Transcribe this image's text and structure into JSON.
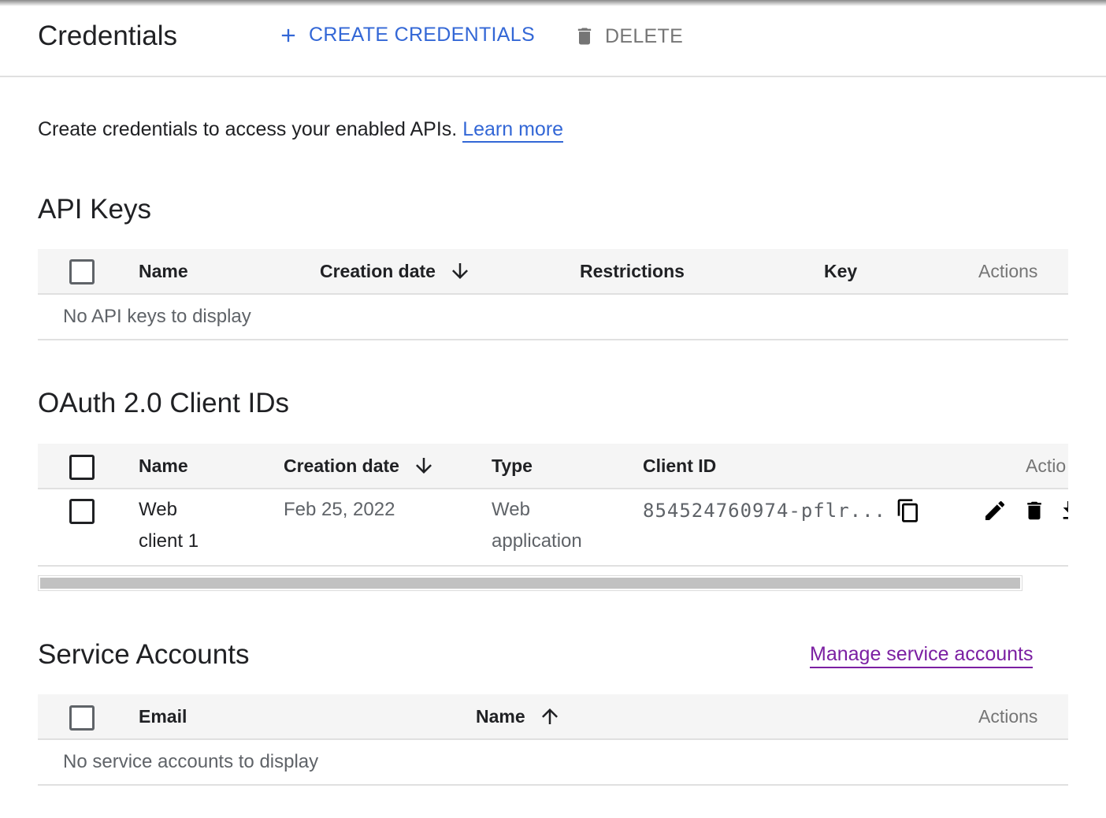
{
  "header": {
    "title": "Credentials",
    "create_label": "CREATE CREDENTIALS",
    "delete_label": "DELETE"
  },
  "intro": {
    "text": "Create credentials to access your enabled APIs.",
    "learn_more": "Learn more"
  },
  "api_keys": {
    "title": "API Keys",
    "columns": [
      "Name",
      "Creation date",
      "Restrictions",
      "Key",
      "Actions"
    ],
    "empty_text": "No API keys to display"
  },
  "oauth": {
    "title": "OAuth 2.0 Client IDs",
    "columns": [
      "Name",
      "Creation date",
      "Type",
      "Client ID",
      "Actio"
    ],
    "rows": [
      {
        "name_line1": "Web",
        "name_line2": "client 1",
        "creation_date": "Feb 25, 2022",
        "type_line1": "Web",
        "type_line2": "application",
        "client_id": "854524760974-pflr..."
      }
    ]
  },
  "service_accounts": {
    "title": "Service Accounts",
    "manage_link": "Manage service accounts",
    "columns": [
      "Email",
      "Name",
      "Actions"
    ],
    "empty_text": "No service accounts to display"
  },
  "colors": {
    "accent": "#3367d6",
    "visited_link": "#7b1fa2",
    "header_bg": "#f5f5f5"
  },
  "icons": {
    "create": "plus-icon",
    "delete": "trash-icon",
    "sort_desc": "arrow-down-icon",
    "sort_asc": "arrow-up-icon",
    "copy": "copy-icon",
    "edit": "pencil-icon",
    "row_delete": "trash-icon",
    "download": "download-icon"
  }
}
